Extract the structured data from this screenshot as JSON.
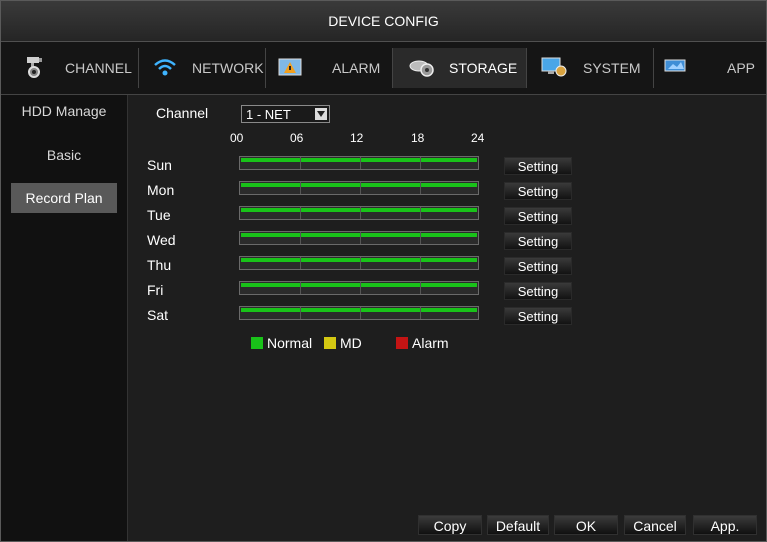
{
  "window": {
    "title": "DEVICE CONFIG"
  },
  "tabs": [
    {
      "label": "CHANNEL",
      "icon": "camera-gear-icon"
    },
    {
      "label": "NETWORK",
      "icon": "wifi-icon"
    },
    {
      "label": "ALARM",
      "icon": "alarm-icon"
    },
    {
      "label": "STORAGE",
      "icon": "storage-gear-icon",
      "active": true
    },
    {
      "label": "SYSTEM",
      "icon": "system-monitor-icon"
    },
    {
      "label": "APP",
      "icon": "app-icon"
    }
  ],
  "sidebar": {
    "items": [
      {
        "label": "HDD Manage"
      },
      {
        "label": "Basic"
      },
      {
        "label": "Record Plan",
        "active": true
      }
    ]
  },
  "record_plan": {
    "channel_label": "Channel",
    "channel_value": "1 - NET",
    "hours": [
      "00",
      "06",
      "12",
      "18",
      "24"
    ],
    "days": [
      "Sun",
      "Mon",
      "Tue",
      "Wed",
      "Thu",
      "Fri",
      "Sat"
    ],
    "setting_label": "Setting",
    "legend": [
      {
        "label": "Normal",
        "color": "#19c219"
      },
      {
        "label": "MD",
        "color": "#d4c812"
      },
      {
        "label": "Alarm",
        "color": "#c41414"
      }
    ]
  },
  "footer": {
    "copy": "Copy",
    "default": "Default",
    "ok": "OK",
    "cancel": "Cancel",
    "apply": "App."
  }
}
